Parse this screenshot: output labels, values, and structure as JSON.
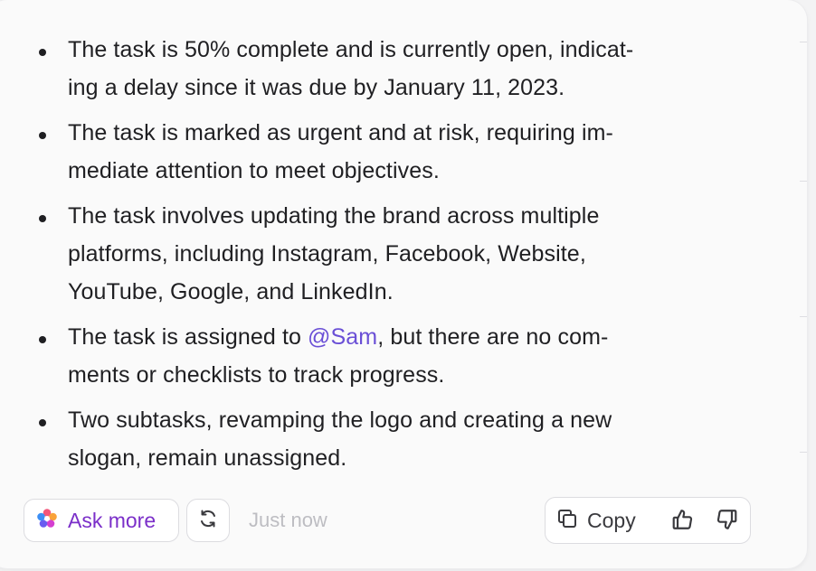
{
  "summary": {
    "bullets": [
      {
        "text": "The task is 50% complete and is currently open, indicat-\ning a delay since it was due by January 11, 2023."
      },
      {
        "text": "The task is marked as urgent and at risk, requiring im-\nmediate attention to meet objectives."
      },
      {
        "text": "The task involves updating the brand across multiple\nplatforms, including Instagram, Facebook, Website,\nYouTube, Google, and LinkedIn."
      },
      {
        "before": "The task is assigned to ",
        "mention": "@Sam",
        "after": ", but there are no com-\nments or checklists to track progress."
      },
      {
        "text": "Two subtasks, revamping the logo and creating a new\nslogan, remain unassigned."
      }
    ]
  },
  "footer": {
    "ask_more_label": "Ask more",
    "timestamp": "Just now",
    "copy_label": "Copy"
  },
  "icons": {
    "ask_more": "sparkle-flower-icon",
    "refresh": "refresh-icon",
    "copy": "copy-icon",
    "thumbs_up": "thumbs-up-icon",
    "thumbs_down": "thumbs-down-icon"
  },
  "colors": {
    "text": "#1f1f22",
    "mention": "#6a4fd6",
    "ask_more": "#7b2fc9",
    "timestamp": "#bdbdc2"
  }
}
